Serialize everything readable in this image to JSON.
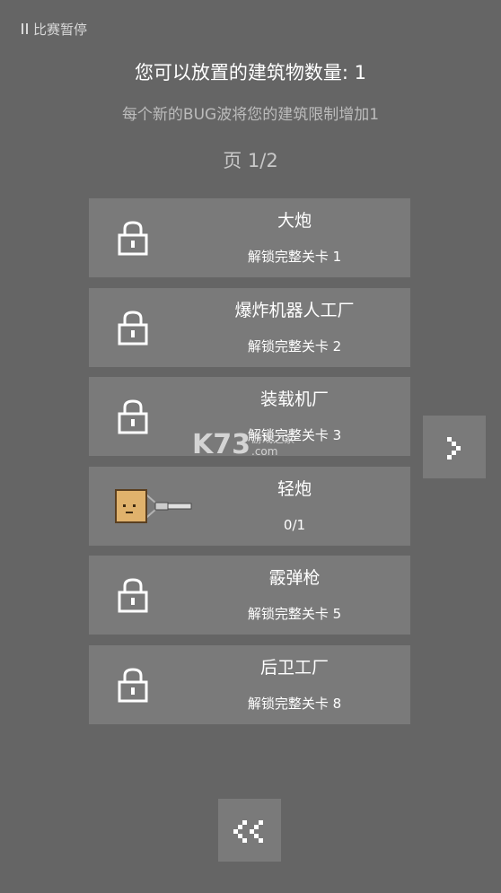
{
  "pause": {
    "label": "比赛暂停",
    "icon": "pause-icon"
  },
  "header": {
    "title": "您可以放置的建筑物数量: 1",
    "subtitle": "每个新的BUG波将您的建筑限制增加1",
    "page": "页 1/2"
  },
  "buildings": [
    {
      "name": "大炮",
      "status": "解锁完整关卡 1",
      "locked": true,
      "icon": "lock-icon"
    },
    {
      "name": "爆炸机器人工厂",
      "status": "解锁完整关卡 2",
      "locked": true,
      "icon": "lock-icon"
    },
    {
      "name": "装载机厂",
      "status": "解锁完整关卡 3",
      "locked": true,
      "icon": "lock-icon"
    },
    {
      "name": "轻炮",
      "status": "0/1",
      "locked": false,
      "icon": "light-cannon-turret-icon"
    },
    {
      "name": "霰弹枪",
      "status": "解锁完整关卡 5",
      "locked": true,
      "icon": "lock-icon"
    },
    {
      "name": "后卫工厂",
      "status": "解锁完整关卡 8",
      "locked": true,
      "icon": "lock-icon"
    }
  ],
  "nav": {
    "next_icon": "chevron-right-icon",
    "back_icon": "double-chevron-left-icon"
  },
  "watermark": {
    "logo": "K73",
    "sub": "游戏之家",
    "url": ".com"
  },
  "colors": {
    "background": "#656565",
    "card": "#7a7a7a",
    "subtitle_text": "#bcbcbc"
  }
}
